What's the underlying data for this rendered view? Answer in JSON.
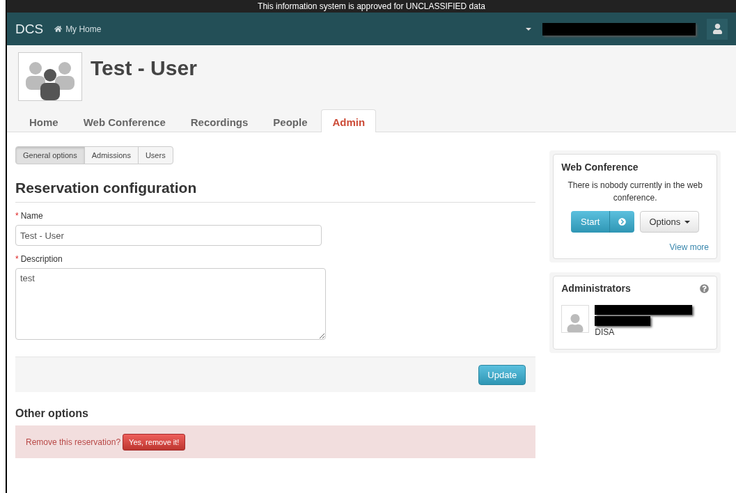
{
  "banner": "This information system is approved for UNCLASSIFIED data",
  "navbar": {
    "brand": "DCS",
    "home_link": "My Home"
  },
  "header": {
    "title": "Test - User"
  },
  "tabs": [
    {
      "label": "Home",
      "selected": false
    },
    {
      "label": "Web Conference",
      "selected": false
    },
    {
      "label": "Recordings",
      "selected": false
    },
    {
      "label": "People",
      "selected": false
    },
    {
      "label": "Admin",
      "selected": true
    }
  ],
  "subtabs": [
    {
      "label": "General options",
      "selected": true
    },
    {
      "label": "Admissions",
      "selected": false
    },
    {
      "label": "Users",
      "selected": false
    }
  ],
  "form": {
    "title": "Reservation configuration",
    "fields": [
      {
        "kind": "input",
        "label": "Name",
        "required_mark": "*",
        "value": "Test - User"
      },
      {
        "kind": "textarea",
        "label": "Description",
        "required_mark": "*",
        "value": "test"
      }
    ],
    "submit": "Update"
  },
  "other_options": {
    "title": "Other options",
    "prompt": "Remove this reservation?",
    "button": "Yes, remove it!"
  },
  "web_conference": {
    "title": "Web Conference",
    "message": "There is nobody currently in the web conference.",
    "start": "Start",
    "options": "Options",
    "view_more": "View more"
  },
  "administrators": {
    "title": "Administrators",
    "items": [
      {
        "organization": "DISA"
      }
    ]
  }
}
